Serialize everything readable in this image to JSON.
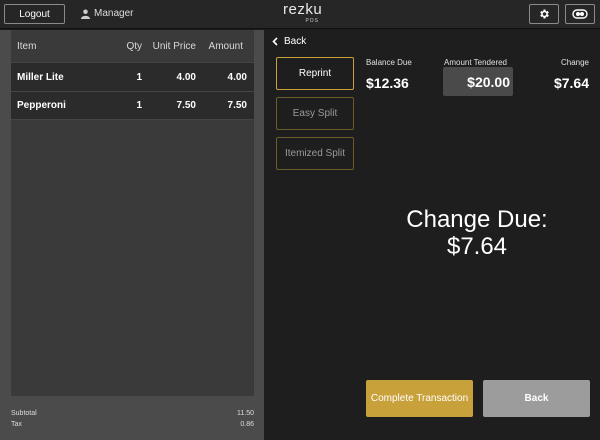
{
  "topbar": {
    "logout_label": "Logout",
    "user_label": "Manager",
    "brand_name": "rezku",
    "brand_sub": "POS"
  },
  "order": {
    "columns": {
      "item": "Item",
      "qty": "Qty",
      "unit_price": "Unit Price",
      "amount": "Amount"
    },
    "rows": [
      {
        "item": "Miller Lite",
        "qty": "1",
        "unit_price": "4.00",
        "amount": "4.00"
      },
      {
        "item": "Pepperoni",
        "qty": "1",
        "unit_price": "7.50",
        "amount": "7.50"
      }
    ],
    "subtotal_label": "Subtotal",
    "subtotal_value": "11.50",
    "tax_label": "Tax",
    "tax_value": "0.86"
  },
  "payment": {
    "back_link": "Back",
    "reprint_label": "Reprint",
    "easy_split_label": "Easy Split",
    "itemized_split_label": "Itemized Split",
    "balance_due_label": "Balance Due",
    "balance_due_value": "$12.36",
    "amount_tendered_label": "Amount Tendered",
    "amount_tendered_value": "$20.00",
    "change_label": "Change",
    "change_value": "$7.64",
    "change_due_title": "Change Due:",
    "change_due_value": "$7.64",
    "complete_label": "Complete Transaction",
    "back_button_label": "Back"
  },
  "colors": {
    "accent": "#c9a13a",
    "panel": "#4b4b4b",
    "dark": "#1e1e1e"
  }
}
